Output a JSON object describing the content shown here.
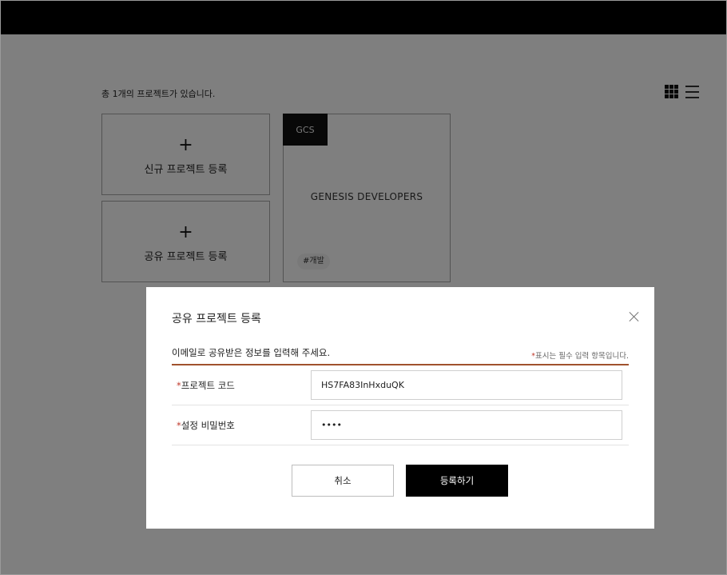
{
  "page": {
    "project_count_text": "총 1개의 프로젝트가 있습니다."
  },
  "view_toggle": {
    "grid_icon": "grid-view-icon",
    "list_icon": "list-view-icon"
  },
  "cards": {
    "new_project": {
      "plus": "+",
      "label": "신규 프로젝트 등록"
    },
    "share_project": {
      "plus": "+",
      "label": "공유 프로젝트 등록"
    },
    "project": {
      "badge": "GCS",
      "name": "GENESIS DEVELOPERS",
      "tag": "#개발"
    }
  },
  "modal": {
    "title": "공유 프로젝트 등록",
    "description": "이메일로 공유받은 정보를 입력해 주세요.",
    "required_star": "*",
    "required_note": "표시는 필수 입력 항목입니다.",
    "fields": {
      "code": {
        "star": "*",
        "label": "프로젝트 코드",
        "value": "HS7FA83InHxduQK"
      },
      "password": {
        "star": "*",
        "label": "설정 비밀번호",
        "value": "••••"
      }
    },
    "buttons": {
      "cancel": "취소",
      "submit": "등록하기"
    }
  },
  "colors": {
    "accent_line": "#a0522d",
    "required_star": "#c0392b",
    "primary_button": "#000000"
  }
}
